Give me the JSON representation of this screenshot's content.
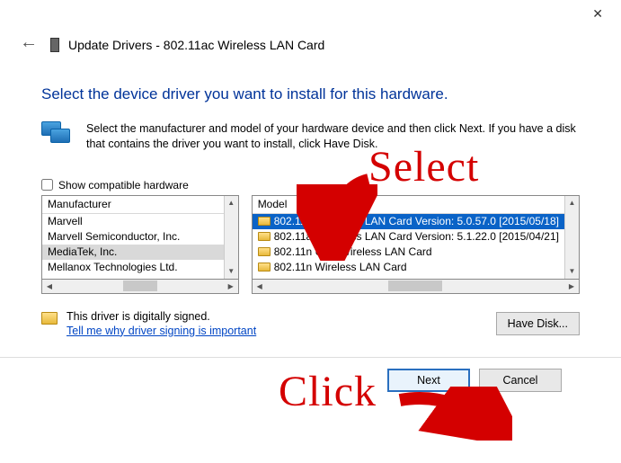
{
  "window": {
    "title": "Update Drivers - 802.11ac Wireless LAN Card",
    "close_glyph": "✕"
  },
  "heading": "Select the device driver you want to install for this hardware.",
  "instruction": "Select the manufacturer and model of your hardware device and then click Next. If you have a disk that contains the driver you want to install, click Have Disk.",
  "checkbox": {
    "label": "Show compatible hardware",
    "checked": false
  },
  "columns": {
    "manufacturer": "Manufacturer",
    "model": "Model"
  },
  "manufacturers": [
    {
      "name": "Marvell",
      "selected": false
    },
    {
      "name": "Marvell Semiconductor, Inc.",
      "selected": false
    },
    {
      "name": "MediaTek, Inc.",
      "selected": true
    },
    {
      "name": "Mellanox Technologies Ltd.",
      "selected": false
    }
  ],
  "models": [
    {
      "name": "802.11ac Wireless LAN Card Version: 5.0.57.0 [2015/05/18]",
      "selected": true
    },
    {
      "name": "802.11ac Wireless LAN Card Version: 5.1.22.0 [2015/04/21]",
      "selected": false
    },
    {
      "name": "802.11n USB Wireless LAN Card",
      "selected": false
    },
    {
      "name": "802.11n Wireless LAN Card",
      "selected": false
    }
  ],
  "signing": {
    "status": "This driver is digitally signed.",
    "link": "Tell me why driver signing is important"
  },
  "buttons": {
    "have_disk": "Have Disk...",
    "next": "Next",
    "cancel": "Cancel"
  },
  "annotations": {
    "select": "Select",
    "click": "Click"
  }
}
